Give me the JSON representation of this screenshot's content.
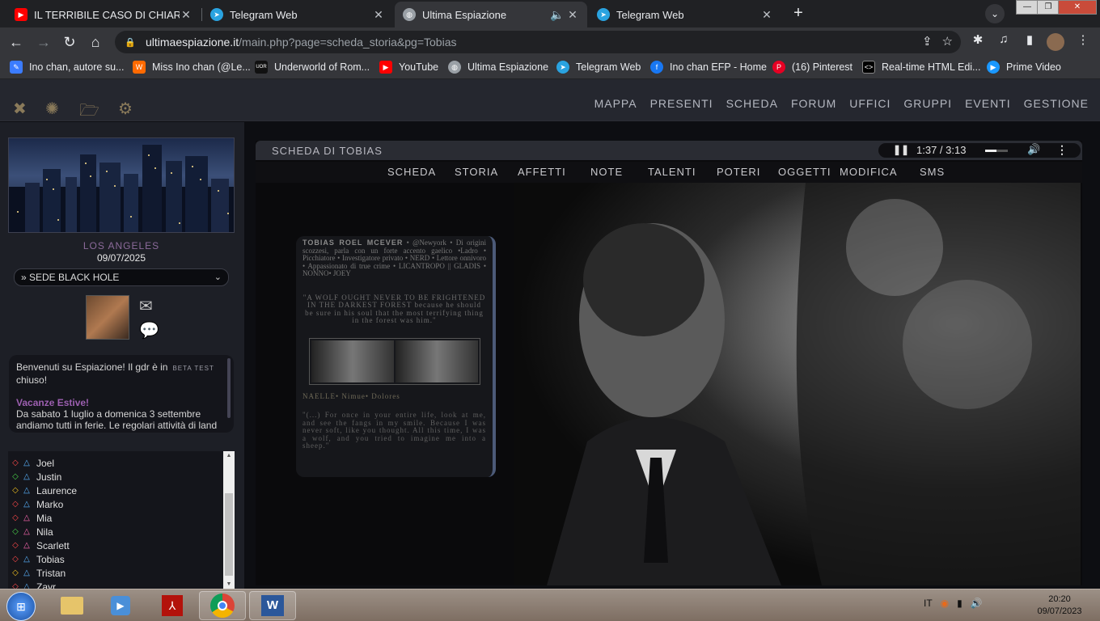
{
  "tabs": [
    {
      "label": "IL TERRIBILE CASO DI CHIARA IN",
      "icon": "youtube-icon",
      "color": "#ff0000"
    },
    {
      "label": "Telegram Web",
      "icon": "telegram-icon",
      "color": "#2aa3e0"
    },
    {
      "label": "Ultima Espiazione",
      "icon": "globe-icon",
      "color": "#9aa0a6"
    },
    {
      "label": "Telegram Web",
      "icon": "telegram-icon",
      "color": "#2aa3e0"
    }
  ],
  "address": {
    "host": "ultimaespiazione.it",
    "path": "/main.php?page=scheda_storia&pg=Tobias"
  },
  "bookmarks": [
    {
      "label": "Ino chan, autore su...",
      "icon": "bookmark-icon",
      "color": "#3b7cff"
    },
    {
      "label": "Miss Ino chan (@Le...",
      "icon": "wattpad-icon",
      "color": "#ff6a00"
    },
    {
      "label": "Underworld of Rom...",
      "icon": "uor-icon",
      "color": "#111111"
    },
    {
      "label": "YouTube",
      "icon": "youtube-icon",
      "color": "#ff0000"
    },
    {
      "label": "Ultima Espiazione",
      "icon": "globe-icon",
      "color": "#9aa0a6"
    },
    {
      "label": "Telegram Web",
      "icon": "telegram-icon",
      "color": "#2aa3e0"
    },
    {
      "label": "Ino chan EFP - Home",
      "icon": "facebook-icon",
      "color": "#1877f2"
    },
    {
      "label": "(16) Pinterest",
      "icon": "pinterest-icon",
      "color": "#e60023"
    },
    {
      "label": "Real-time HTML Edi...",
      "icon": "code-icon",
      "color": "#000000"
    },
    {
      "label": "Prime Video",
      "icon": "prime-video-icon",
      "color": "#1a98ff"
    }
  ],
  "site_menu": [
    "MAPPA",
    "PRESENTI",
    "SCHEDA",
    "FORUM",
    "UFFICI",
    "GRUPPI",
    "EVENTI",
    "GESTIONE"
  ],
  "sidebar": {
    "location": "LOS ANGELES",
    "date": "09/07/2025",
    "select_value": "» SEDE BLACK HOLE",
    "news_text": "Benvenuti su Espiazione! Il gdr è in",
    "news_badge": "BETA TEST",
    "news_text2": "chiuso!",
    "news_title": "Vacanze Estive!",
    "news_body": "Da sabato 1 luglio a domenica 3 settembre andiamo tutti in ferie. Le regolari attività di land",
    "users": [
      {
        "name": "Joel",
        "diamond": "#ff4a4a",
        "tri": "#5ab4ff"
      },
      {
        "name": "Justin",
        "diamond": "#4ad24a",
        "tri": "#5ab4ff"
      },
      {
        "name": "Laurence",
        "diamond": "#f0c020",
        "tri": "#5ab4ff"
      },
      {
        "name": "Marko",
        "diamond": "#ff4a4a",
        "tri": "#5ab4ff"
      },
      {
        "name": "Mia",
        "diamond": "#ff4a4a",
        "tri": "#ff6ab4"
      },
      {
        "name": "Nila",
        "diamond": "#4ad24a",
        "tri": "#ff6ab4"
      },
      {
        "name": "Scarlett",
        "diamond": "#ff4a4a",
        "tri": "#ff6ab4"
      },
      {
        "name": "Tobias",
        "diamond": "#ff4a4a",
        "tri": "#5ab4ff"
      },
      {
        "name": "Tristan",
        "diamond": "#f0c020",
        "tri": "#5ab4ff"
      },
      {
        "name": "Zayr",
        "diamond": "#ff4a4a",
        "tri": "#5ab4ff"
      }
    ]
  },
  "panel": {
    "title": "SCHEDA DI TOBIAS",
    "audio_time": "1:37 / 3:13",
    "tabs": [
      "SCHEDA",
      "STORIA",
      "AFFETTI",
      "NOTE",
      "TALENTI",
      "POTERI",
      "OGGETTI",
      "MODIFICA",
      "SMS"
    ],
    "card": {
      "name": "TOBIAS ROEL MCEVER",
      "bio": "• @Newyork • Di origini scozzesi, parla con un forte accento gaelico •Ladro • Picchiatore • Investigatore privato • NERD • Lettore onnivoro • Appassionato di true crime • LICANTROPO || GLADIS • NONNO• JOEY",
      "quote": "\"A WOLF OUGHT NEVER TO BE FRIGHTENED IN THE DARKEST FOREST because he should be sure in his soul that the most terrifying thing in the forest was him.\"",
      "relations": "NAELLE• Nimue• Dolores",
      "quote2": "\"(...) For once in your entire life, look at me, and see the fangs in my smile. Because I was never soft, like you thought. All this time, I was a wolf, and you tried to imagine me into a sheep.\""
    }
  },
  "taskbar": {
    "lang": "IT",
    "time": "20:20",
    "date": "09/07/2023"
  }
}
